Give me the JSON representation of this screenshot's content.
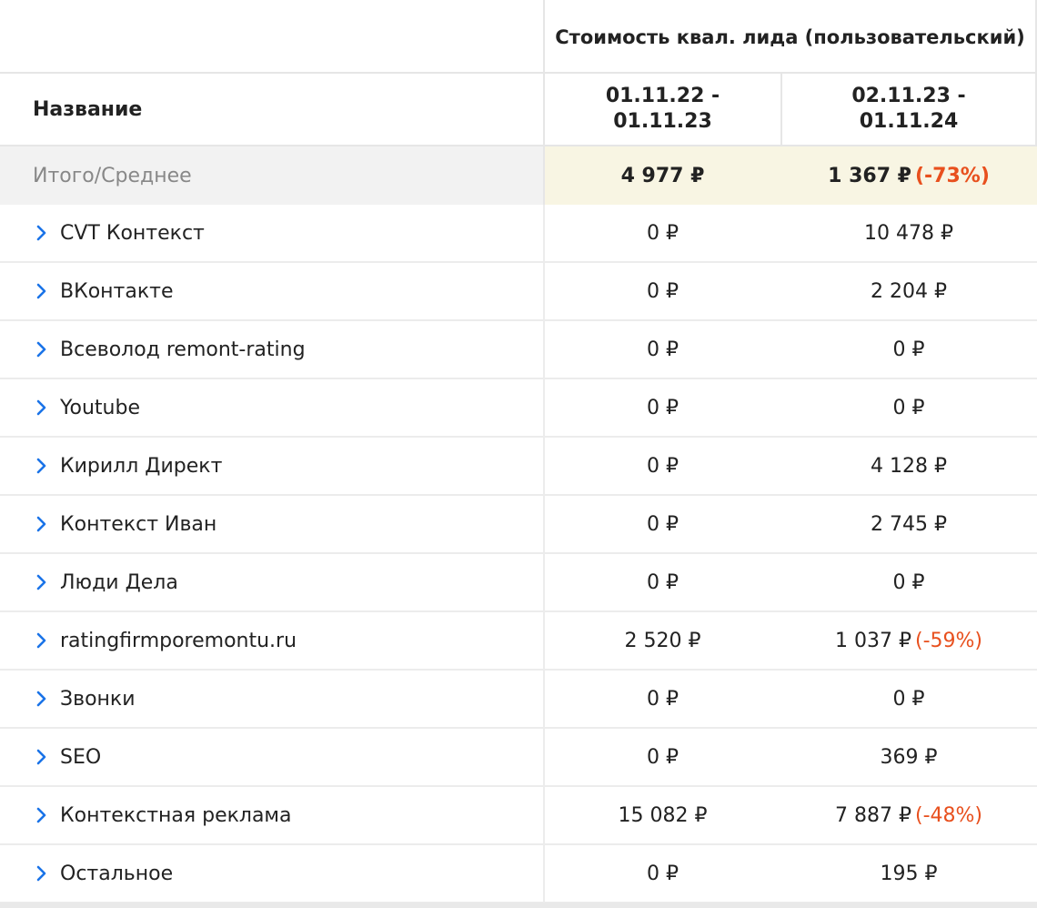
{
  "header": {
    "group_title": "Стоимость квал. лида (пользовательский)",
    "name_label": "Название",
    "period1": "01.11.22 - 01.11.23",
    "period2": "02.11.23 - 01.11.24"
  },
  "total": {
    "label": "Итого/Среднее",
    "v1": "4 977 ₽",
    "v2": "1 367 ₽",
    "diff": "(-73%)"
  },
  "rows": [
    {
      "name": "CVT Контекст",
      "v1": "0 ₽",
      "v2": "10 478 ₽",
      "diff": ""
    },
    {
      "name": "ВКонтакте",
      "v1": "0 ₽",
      "v2": "2 204 ₽",
      "diff": ""
    },
    {
      "name": "Всеволод remont-rating",
      "v1": "0 ₽",
      "v2": "0 ₽",
      "diff": ""
    },
    {
      "name": "Youtube",
      "v1": "0 ₽",
      "v2": "0 ₽",
      "diff": ""
    },
    {
      "name": "Кирилл Директ",
      "v1": "0 ₽",
      "v2": "4 128 ₽",
      "diff": ""
    },
    {
      "name": "Контекст Иван",
      "v1": "0 ₽",
      "v2": "2 745 ₽",
      "diff": ""
    },
    {
      "name": "Люди Дела",
      "v1": "0 ₽",
      "v2": "0 ₽",
      "diff": ""
    },
    {
      "name": "ratingfirmporemontu.ru",
      "v1": "2 520 ₽",
      "v2": "1 037 ₽",
      "diff": "(-59%)"
    },
    {
      "name": "Звонки",
      "v1": "0 ₽",
      "v2": "0 ₽",
      "diff": ""
    },
    {
      "name": "SEO",
      "v1": "0 ₽",
      "v2": "369 ₽",
      "diff": ""
    },
    {
      "name": "Контекстная реклама",
      "v1": "15 082 ₽",
      "v2": "7 887 ₽",
      "diff": "(-48%)"
    },
    {
      "name": "Остальное",
      "v1": "0 ₽",
      "v2": "195 ₽",
      "diff": ""
    }
  ],
  "icons": {
    "expand": "chevron-right-icon"
  },
  "colors": {
    "accent": "#1a73e8",
    "negative": "#e8501e",
    "total_highlight": "#f8f5e3"
  }
}
